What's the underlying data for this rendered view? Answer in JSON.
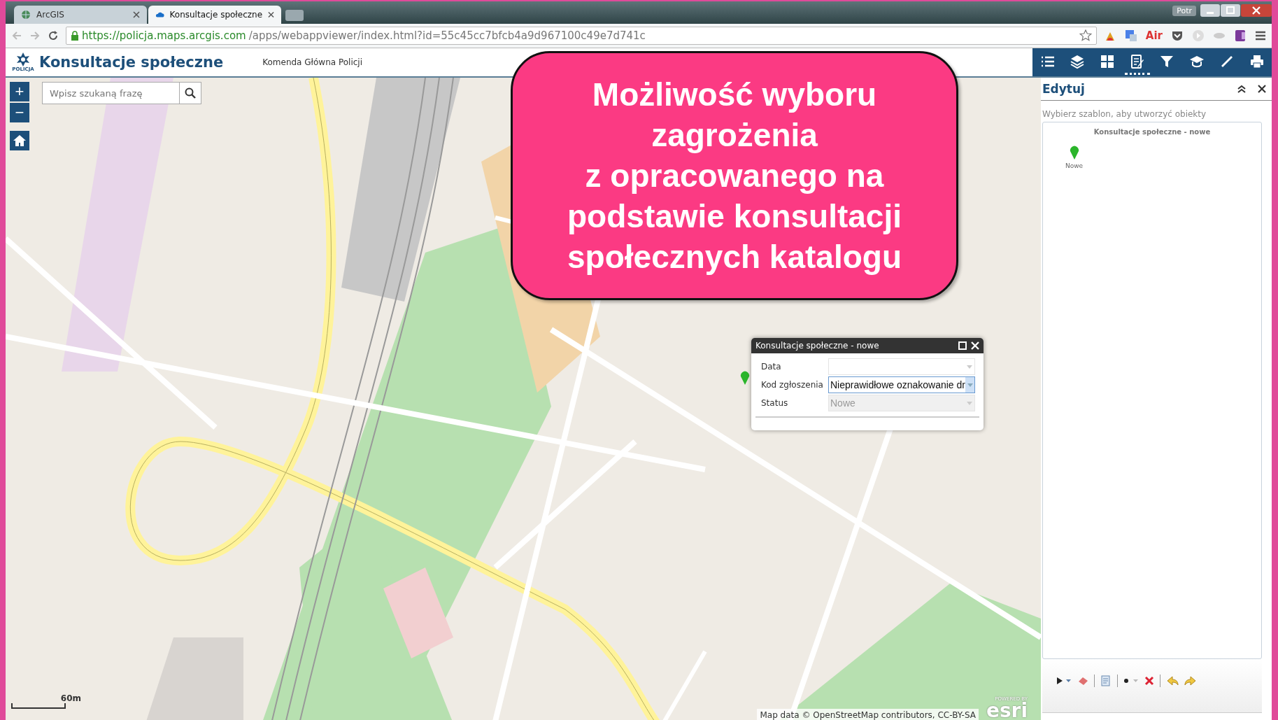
{
  "browser": {
    "tabs": [
      {
        "title": "ArcGIS",
        "selected": false
      },
      {
        "title": "Konsultacje społeczne",
        "selected": true
      }
    ],
    "user": "Potr",
    "url": {
      "host": "https://policja.maps.arcgis.com",
      "path": "/apps/webappviewer/index.html?id=55c45cc7bfcb4a9d967100c49e7d741c"
    },
    "extension_label": "Air"
  },
  "app": {
    "logo_caption": "POLICJA",
    "title": "Konsultacje społeczne",
    "subtitle": "Komenda Główna Policji",
    "search": {
      "placeholder": "Wpisz szukaną frazę"
    },
    "map_controls": [
      {
        "kind": "zoom-in",
        "label": "+"
      },
      {
        "kind": "zoom-out",
        "label": "−"
      },
      {
        "kind": "home"
      }
    ],
    "widgets": [
      {
        "kind": "list",
        "selected": false
      },
      {
        "kind": "layers",
        "selected": false
      },
      {
        "kind": "grid",
        "selected": false
      },
      {
        "kind": "edit",
        "selected": true
      },
      {
        "kind": "filter",
        "selected": false
      },
      {
        "kind": "cap",
        "selected": false
      },
      {
        "kind": "ruler",
        "selected": false
      },
      {
        "kind": "print",
        "selected": false
      }
    ],
    "callout": {
      "lines": [
        "Możliwość wyboru",
        "zagrożenia",
        "z opracowanego na",
        "podstawie konsultacji",
        "społecznych katalogu"
      ]
    },
    "popup": {
      "title": "Konsultacje społeczne - nowe",
      "fields": [
        {
          "label": "Data",
          "focused": false,
          "disabled": false
        },
        {
          "label": "Kod zgłoszenia",
          "value": "Nieprawidłowe oznakowanie dr",
          "focused": true,
          "disabled": false
        },
        {
          "label": "Status",
          "value": "Nowe",
          "focused": false,
          "disabled": true
        }
      ]
    },
    "scale": "60m",
    "attribution": "Map data © OpenStreetMap contributors, CC-BY-SA",
    "esri": {
      "caption": "POWERED BY",
      "logo": "esri"
    },
    "panel": {
      "title": "Edytuj",
      "hint": "Wybierz szablon, aby utworzyć obiekty",
      "group": "Konsultacje społeczne - nowe",
      "templates": [
        {
          "label": "Nowe",
          "color": "#2bb52b"
        }
      ]
    }
  }
}
